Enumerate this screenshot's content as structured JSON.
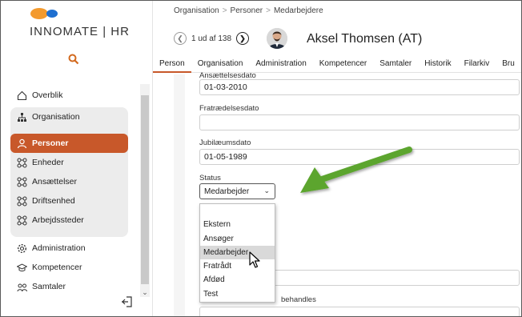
{
  "app": {
    "logo_text": "INNOMATE | HR",
    "brand_colors": {
      "orange": "#f39a2e",
      "blue": "#1e6fd0",
      "accent": "#c8582a"
    }
  },
  "sidebar": {
    "search_icon": "search-icon",
    "items_top": [
      {
        "label": "Overblik",
        "icon": "home-icon"
      },
      {
        "label": "Organisation",
        "icon": "org-chart-icon"
      }
    ],
    "org_items": [
      {
        "label": "Personer",
        "icon": "person-icon",
        "active": true
      },
      {
        "label": "Enheder",
        "icon": "nodes-icon"
      },
      {
        "label": "Ansættelser",
        "icon": "nodes-icon"
      },
      {
        "label": "Driftsenhed",
        "icon": "nodes-icon"
      },
      {
        "label": "Arbejdssteder",
        "icon": "nodes-icon"
      }
    ],
    "items_bottom": [
      {
        "label": "Administration",
        "icon": "gear-icon"
      },
      {
        "label": "Kompetencer",
        "icon": "graduation-cap-icon"
      },
      {
        "label": "Samtaler",
        "icon": "people-chat-icon"
      }
    ]
  },
  "header": {
    "breadcrumb": [
      "Organisation",
      "Personer",
      "Medarbejdere"
    ],
    "pager_text": "1 ud af 138",
    "person_name": "Aksel Thomsen (AT)"
  },
  "tabs": [
    "Person",
    "Organisation",
    "Administration",
    "Kompetencer",
    "Samtaler",
    "Historik",
    "Filarkiv",
    "Bru"
  ],
  "form": {
    "ansaettelsesdato_label": "Ansættelsesdato",
    "ansaettelsesdato_value": "01-03-2010",
    "fratraedelsesdato_label": "Fratrædelsesdato",
    "fratraedelsesdato_value": "",
    "jubilaeumsdato_label": "Jubilæumsdato",
    "jubilaeumsdato_value": "01-05-1989",
    "status_label": "Status",
    "status_value": "Medarbejder",
    "status_options": [
      "",
      "Ekstern",
      "Ansøger",
      "Medarbejder",
      "Fratrådt",
      "Afdød",
      "Test"
    ],
    "hidden_label_fragment": "behandles"
  }
}
